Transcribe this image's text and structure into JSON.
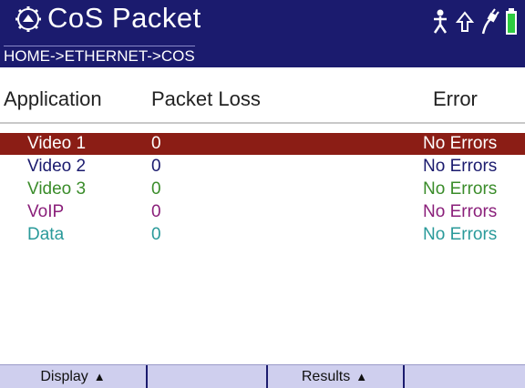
{
  "header": {
    "title": "CoS Packet",
    "breadcrumb": "HOME->ETHERNET->COS",
    "icons": [
      "gear-icon",
      "person-icon",
      "up-arrow-icon",
      "plug-icon",
      "battery-icon"
    ],
    "battery_color": "#2ecc40"
  },
  "table": {
    "columns": [
      "Application",
      "Packet Loss",
      "Error"
    ],
    "rows": [
      {
        "app": "Video 1",
        "loss": "0",
        "error": "No Errors",
        "color": "#ffffff",
        "selected": true
      },
      {
        "app": "Video 2",
        "loss": "0",
        "error": "No Errors",
        "color": "#1b1b6e",
        "selected": false
      },
      {
        "app": "Video 3",
        "loss": "0",
        "error": "No Errors",
        "color": "#3a8c2a",
        "selected": false
      },
      {
        "app": "VoIP",
        "loss": "0",
        "error": "No Errors",
        "color": "#8a1f7a",
        "selected": false
      },
      {
        "app": "Data",
        "loss": "0",
        "error": "No Errors",
        "color": "#2a9a9a",
        "selected": false
      }
    ],
    "selected_row_color": "#8b1d15"
  },
  "softkeys": [
    {
      "label": "Display",
      "has_arrow": true
    },
    {
      "label": "",
      "has_arrow": false
    },
    {
      "label": "Results",
      "has_arrow": true
    },
    {
      "label": "",
      "has_arrow": false
    }
  ]
}
